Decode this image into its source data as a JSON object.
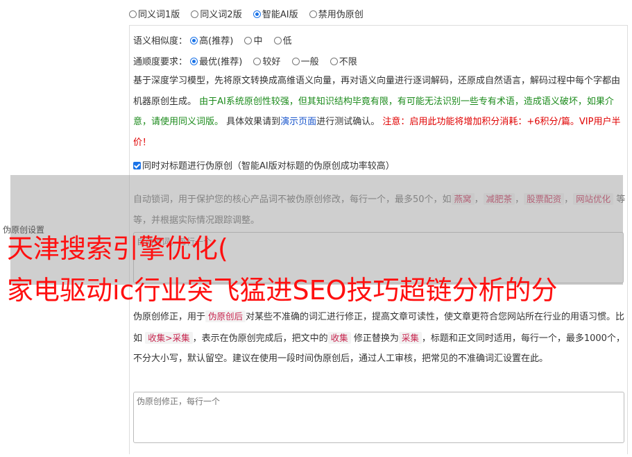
{
  "modes": [
    {
      "label": "同义词1版",
      "selected": false
    },
    {
      "label": "同义词2版",
      "selected": false
    },
    {
      "label": "智能AI版",
      "selected": true
    },
    {
      "label": "禁用伪原创",
      "selected": false
    }
  ],
  "similarity": {
    "label": "语义相似度：",
    "options": [
      {
        "label": "高(推荐)",
        "selected": true
      },
      {
        "label": "中",
        "selected": false
      },
      {
        "label": "低",
        "selected": false
      }
    ]
  },
  "fluency": {
    "label": "通顺度要求：",
    "options": [
      {
        "label": "最优(推荐)",
        "selected": true
      },
      {
        "label": "较好",
        "selected": false
      },
      {
        "label": "一般",
        "selected": false
      },
      {
        "label": "不限",
        "selected": false
      }
    ]
  },
  "description": {
    "p1": "基于深度学习模型，先将原文转换成高维语义向量，再对语义向量进行逐词解码，还原成自然语言，解码过程中每个字都由机器原创生成。",
    "green": "由于AI系统原创性较强，但其知识结构毕竟有限，有可能无法识别一些专有术语，造成语义破坏，如果介意，请使用同义词版。",
    "p2": "具体效果请到",
    "link": "演示页面",
    "p3": "进行测试确认。",
    "red": "注意：启用此功能将增加积分消耗：+6积分/篇。VIP用户半价！"
  },
  "title_checkbox": {
    "label": "同时对标题进行伪原创（智能AI版对标题的伪原创成功率较高）",
    "checked": true
  },
  "lock_words": {
    "intro": "自动锁词，用于保护您的核心产品词不被伪原创修改，每行一个，最多50个，如",
    "examples": [
      "燕窝",
      "减肥茶",
      "股票配资",
      "网站优化"
    ],
    "sep": "，",
    "outro": "等等，并根据实际情况跟踪调整。",
    "placeholder": "自动锁词，每行一个"
  },
  "side_label": "伪原创设置",
  "overlay_title": {
    "line1": "天津搜索引擎优化(",
    "line2": "家电驱动ic行业突飞猛进SEO技巧超链分析的分"
  },
  "correction": {
    "t1": "伪原创修正，用于",
    "tag1": "伪原创后",
    "t2": "对某些不准确的词汇进行修正，提高文章可读性，使文章更符合您网站所在行业的用语习惯。比如",
    "tag2": "收集>采集",
    "t3": "，表示在伪原创完成后，把文中的",
    "tag3": "收集",
    "t4": "修正替换为",
    "tag4": "采集",
    "t5": "，标题和正文同时适用，每行一个，最多1000个，不分大小写，默认留空。建议在使用一段时间伪原创后，通过人工审核，把常见的不准确词汇设置在此。",
    "placeholder": "伪原创修正，每行一个"
  },
  "colors": {
    "accent": "#1a73e8",
    "green": "#1b8a1b",
    "red": "#e00000",
    "link": "#1a56cc"
  }
}
